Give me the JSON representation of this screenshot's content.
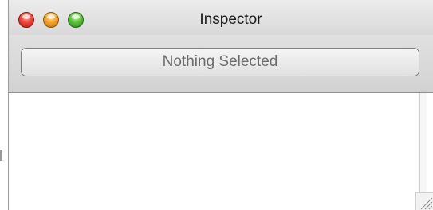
{
  "window": {
    "title": "Inspector",
    "controls": {
      "close_icon": "close-icon",
      "minimize_icon": "minimize-icon",
      "zoom_icon": "zoom-icon"
    }
  },
  "toolbar": {
    "selection_label": "Nothing Selected"
  },
  "resize_icon": "resize-grip-icon"
}
